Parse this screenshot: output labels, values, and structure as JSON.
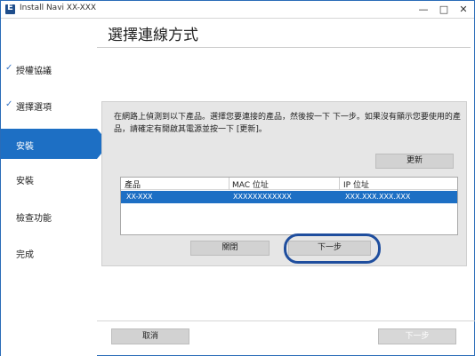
{
  "window": {
    "title": "Install Navi  XX-XXX",
    "icon": "epson-e-icon",
    "controls": [
      "—",
      "□",
      "✕"
    ]
  },
  "header": {
    "title": "選擇連線方式"
  },
  "sidebar": {
    "items": [
      {
        "label": "授權協議",
        "done": true,
        "check": "✓"
      },
      {
        "label": "選擇選項",
        "done": true,
        "check": "✓"
      },
      {
        "label": "安裝",
        "active": true
      },
      {
        "label": "安裝"
      },
      {
        "label": "檢查功能"
      },
      {
        "label": "完成"
      }
    ]
  },
  "main": {
    "message": "在網路上偵測到以下產品。選擇您要連接的產品，然後按一下 下一步。如果沒有顯示您要使用的產品，請確定有開啟其電源並按一下 [更新]。",
    "refresh_label": "更新",
    "table": {
      "columns": [
        "產品",
        "MAC 位址",
        "IP 位址"
      ],
      "rows": [
        [
          "XX-XXX",
          "XXXXXXXXXXXX",
          "XXX.XXX.XXX.XXX"
        ]
      ]
    },
    "close_label": "關閉",
    "next_label": "下一步"
  },
  "footer": {
    "cancel_label": "取消",
    "next_label": "下一步"
  },
  "colors": {
    "accent": "#1d6fc4",
    "highlight_ring": "#1f4e9e",
    "panel_bg": "#e6e6e6",
    "button_bg": "#d2d2d2"
  }
}
